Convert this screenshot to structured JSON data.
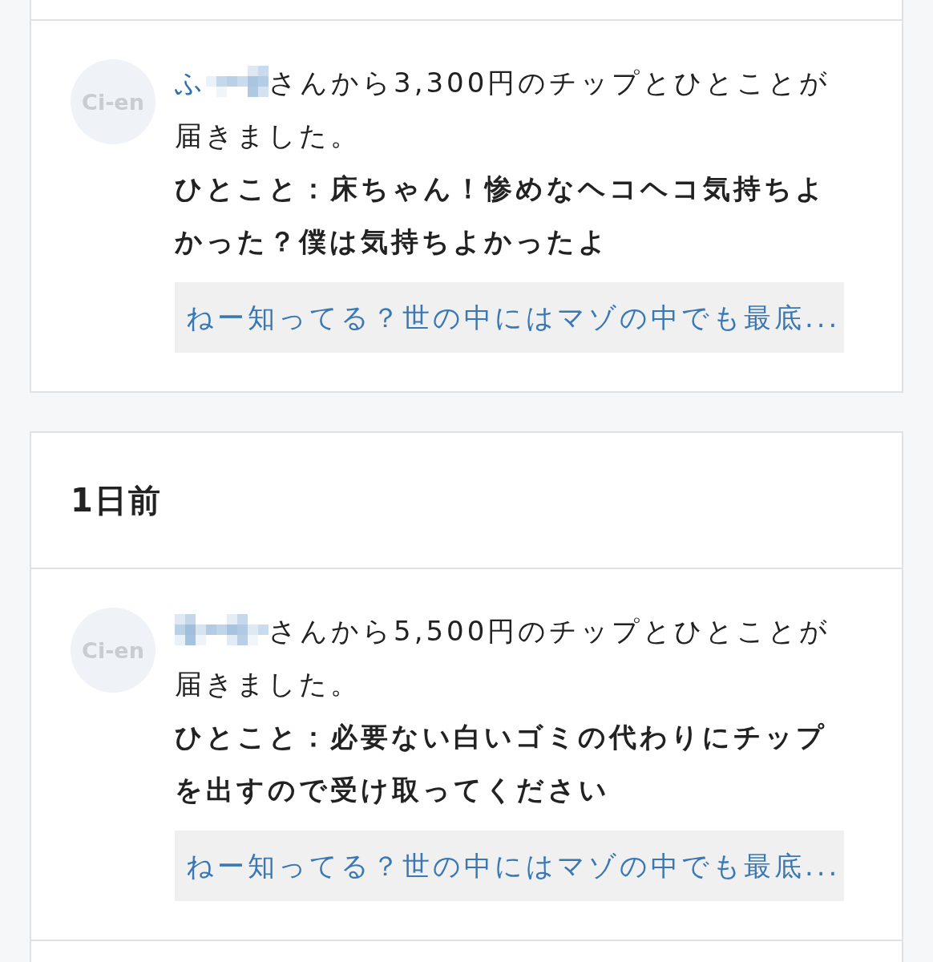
{
  "cards": [
    {
      "items": [
        {
          "avatar": "Ci-en",
          "user": "ふ",
          "message": "さんから3,300円のチップとひとことが届きました。",
          "comment": "ひとこと：床ちゃん！惨めなヘコヘコ気持ちよかった？僕は気持ちよかったよ",
          "post_link": "ねー知ってる？世の中にはマゾの中でも最底..."
        }
      ]
    },
    {
      "header": "1日前",
      "items": [
        {
          "avatar": "Ci-en",
          "message": "さんから5,500円のチップとひとことが届きました。",
          "comment": "ひとこと：必要ない白いゴミの代わりにチップを出すので受け取ってください",
          "post_link": "ねー知ってる？世の中にはマゾの中でも最底..."
        }
      ]
    }
  ]
}
